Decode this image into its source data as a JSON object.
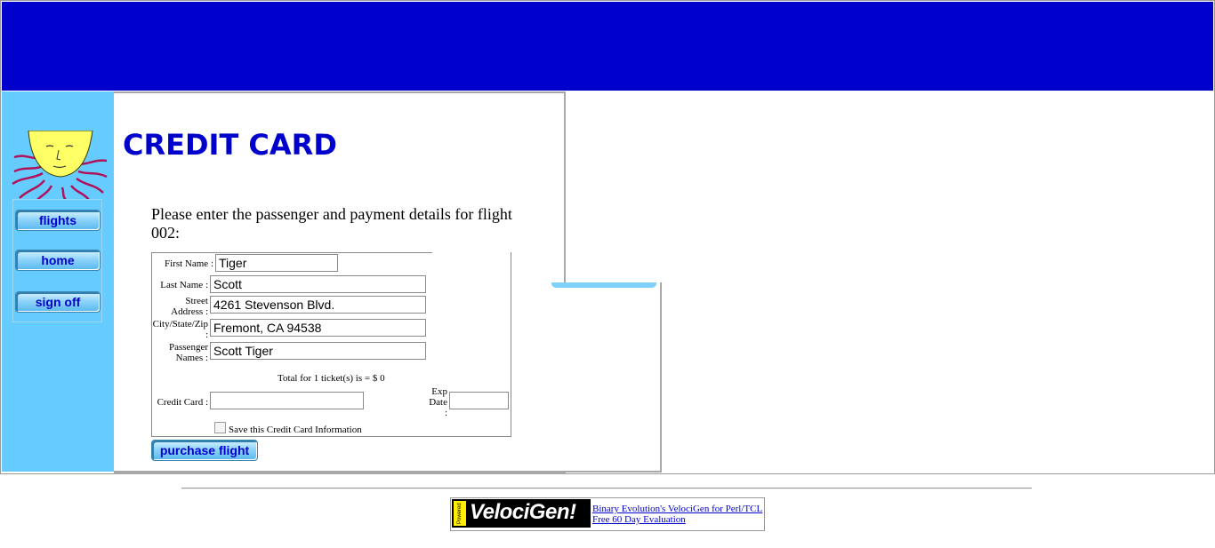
{
  "sidebar": {
    "items": [
      {
        "label": "flights"
      },
      {
        "label": "home"
      },
      {
        "label": "sign off"
      }
    ]
  },
  "main": {
    "title": "CREDIT CARD",
    "intro": "Please enter the passenger and payment details for flight 002:"
  },
  "form": {
    "first_name_label": "First Name :",
    "first_name_value": "Tiger",
    "last_name_label": "Last Name :",
    "last_name_value": "Scott",
    "street_label_1": "Street",
    "street_label_2": "Address :",
    "street_value": "4261 Stevenson Blvd.",
    "city_label_1": "City/State/Zip",
    "city_label_2": ":",
    "city_value": "Fremont, CA 94538",
    "passenger_label_1": "Passenger",
    "passenger_label_2": "Names :",
    "passenger_value": "Scott Tiger",
    "total_text": "Total for 1 ticket(s) is = $ 0",
    "credit_card_label": "Credit Card :",
    "credit_card_value": "",
    "exp_label_1": "Exp",
    "exp_label_2": "Date",
    "exp_label_3": ":",
    "exp_value": "",
    "save_label": "Save this Credit Card Information",
    "save_checked": false,
    "purchase_label": "purchase flight"
  },
  "footer": {
    "powered_by": "Powered By",
    "logo_text": "VelociGen!",
    "link1": "Binary Evolution's VelociGen for Perl/TCL",
    "link2": "Free 60 Day Evaluation"
  },
  "colors": {
    "header_blue": "#0000cc",
    "sidebar_blue": "#66ccff",
    "title_blue": "#0000cc"
  }
}
